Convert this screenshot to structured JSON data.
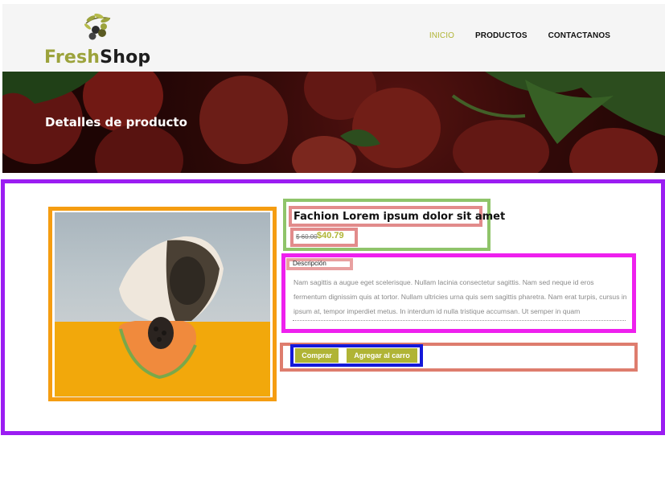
{
  "brand": {
    "name_part1": "Fresh",
    "name_part2": "Shop"
  },
  "nav": [
    {
      "label": "INICIO",
      "active": true
    },
    {
      "label": "PRODUCTOS",
      "active": false
    },
    {
      "label": "CONTACTANOS",
      "active": false
    }
  ],
  "hero": {
    "title": "Detalles de producto"
  },
  "product": {
    "title": "Fachion Lorem ipsum dolor sit amet",
    "price_old": "$ 60.00",
    "price_new": "$40.79",
    "description_label": "Descripción",
    "description": "Nam sagittis a augue eget scelerisque. Nullam lacinia consectetur sagittis. Nam sed neque id eros fermentum dignissim quis at tortor. Nullam ultricies urna quis sem sagittis pharetra. Nam erat turpis, cursus in ipsum at, tempor imperdiet metus. In interdum id nulla tristique accumsan. Ut semper in quam"
  },
  "buttons": {
    "buy": "Comprar",
    "add_to_cart": "Agregar al carro"
  },
  "colors": {
    "accent": "#b0b435",
    "frame": "#9b1df2"
  }
}
